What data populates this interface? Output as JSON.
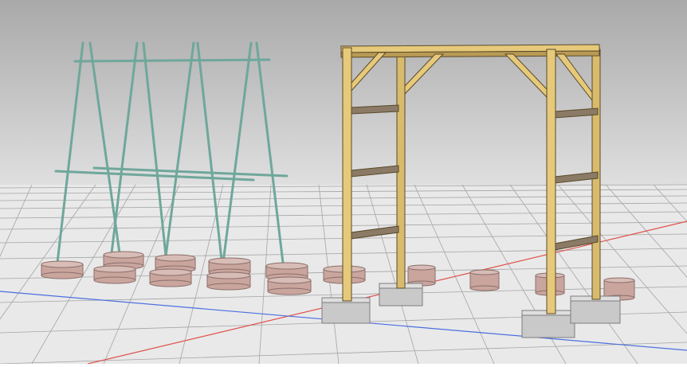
{
  "scene": {
    "colors": {
      "sky_top": "#a9a9a9",
      "sky_bottom": "#efefef",
      "ground": "#eaeaea",
      "grid_line": "#8c8c8c",
      "x_axis": "#e0504a",
      "y_axis": "#4a6ee0",
      "trellis_pole": "#6fa79b",
      "pot": "#c9a59e",
      "pot_top": "#d8bcb6",
      "timber": "#e6c97a",
      "timber_dark": "#b89a55",
      "crossbar": "#8a7a66",
      "footing": "#c9c9c9"
    },
    "objects": [
      {
        "name": "pole-trellis",
        "material": "poles"
      },
      {
        "name": "planter-pots",
        "material": "clay"
      },
      {
        "name": "timber-arbor",
        "material": "wood"
      },
      {
        "name": "concrete-footings",
        "material": "concrete"
      }
    ]
  }
}
